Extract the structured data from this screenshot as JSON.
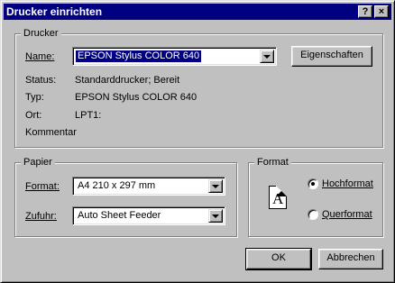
{
  "window": {
    "title": "Drucker einrichten",
    "help_button": "?",
    "close_button": "×"
  },
  "printer_group": {
    "legend": "Drucker",
    "name_label": "Name:",
    "name_value": "EPSON Stylus COLOR 640",
    "properties_button": "Eigenschaften",
    "status_label": "Status:",
    "status_value": "Standarddrucker; Bereit",
    "type_label": "Typ:",
    "type_value": "EPSON Stylus COLOR 640",
    "location_label": "Ort:",
    "location_value": "LPT1:",
    "comment_label": "Kommentar",
    "comment_value": ""
  },
  "paper_group": {
    "legend": "Papier",
    "format_label": "Format:",
    "format_value": "A4 210 x 297 mm",
    "feed_label": "Zufuhr:",
    "feed_value": "Auto Sheet Feeder"
  },
  "orientation_group": {
    "legend": "Format",
    "icon_letter": "A",
    "portrait_label": "Hochformat",
    "portrait_selected": true,
    "landscape_label": "Querformat",
    "landscape_selected": false
  },
  "footer": {
    "ok_button": "OK",
    "cancel_button": "Abbrechen"
  },
  "colors": {
    "titlebar": "#000080",
    "face": "#c0c0c0",
    "selection": "#000080"
  }
}
